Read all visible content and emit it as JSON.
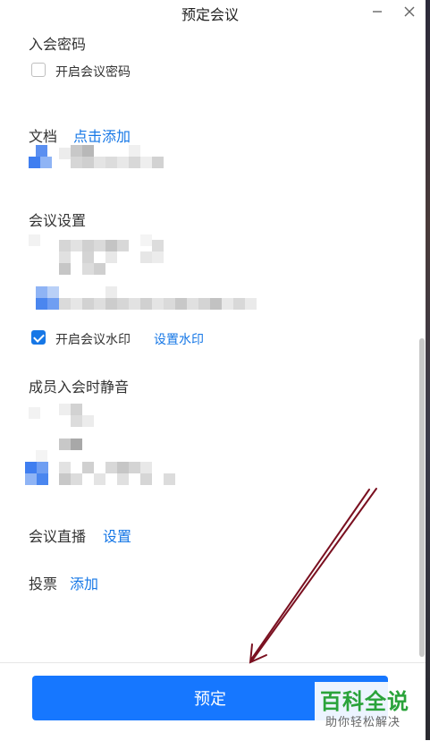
{
  "window": {
    "title": "预定会议",
    "minimize_icon": "minimize-icon",
    "close_icon": "close-icon"
  },
  "password_section": {
    "title": "入会密码",
    "checkbox_label": "开启会议密码",
    "checked": false
  },
  "document_section": {
    "title": "文档",
    "add_link": "点击添加"
  },
  "settings_section": {
    "title": "会议设置",
    "watermark_label": "开启会议水印",
    "watermark_checked": true,
    "watermark_link": "设置水印"
  },
  "mute_section": {
    "title": "成员入会时静音"
  },
  "live_section": {
    "title": "会议直播",
    "link": "设置"
  },
  "vote_section": {
    "title": "投票",
    "link": "添加"
  },
  "footer": {
    "book_button": "预定"
  },
  "watermark": {
    "main": "百科全说",
    "sub": "助你轻松解决"
  },
  "colors": {
    "accent": "#1677e6",
    "primary_button": "#1677ff",
    "annotation_arrow": "#7a1020",
    "watermark_green": "#2aa33a"
  }
}
